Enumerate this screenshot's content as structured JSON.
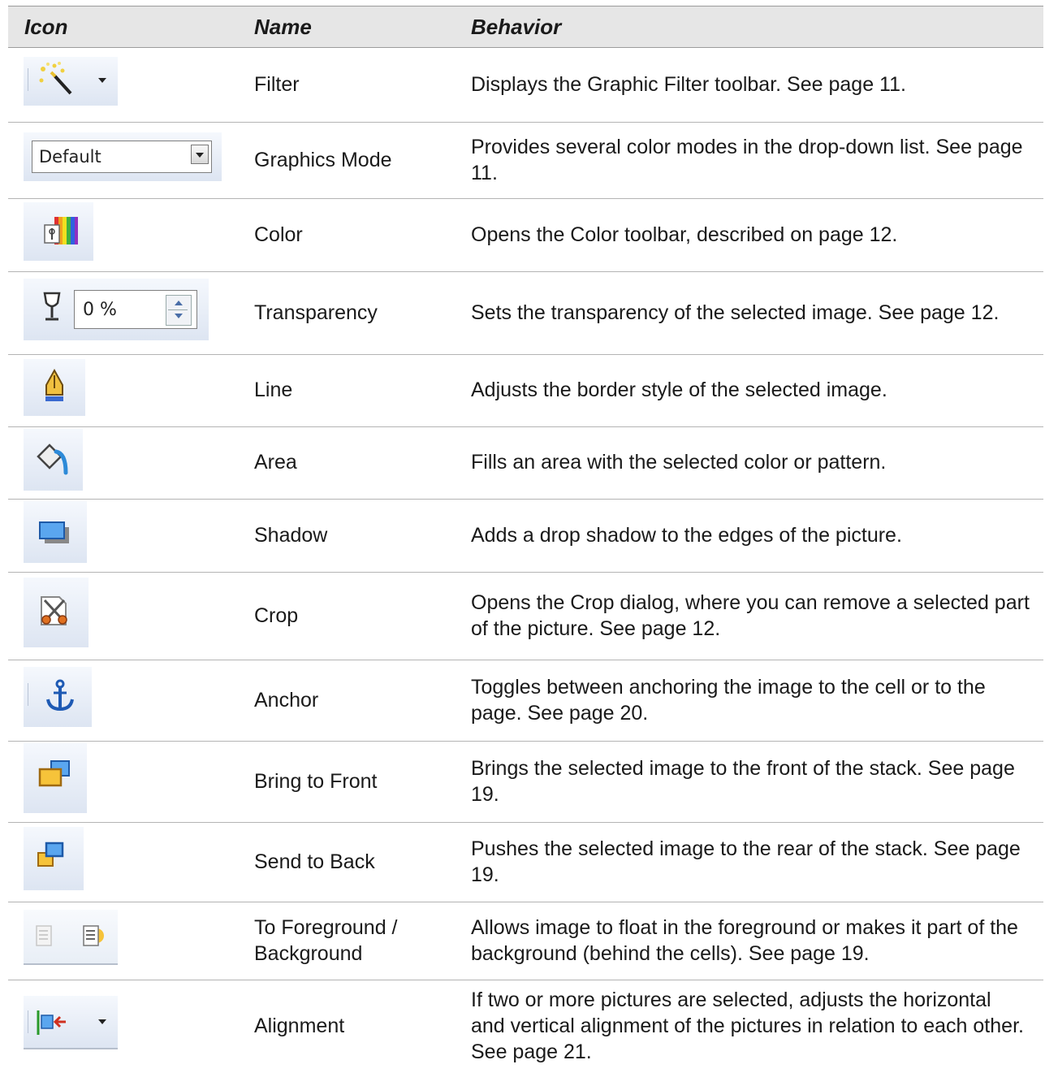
{
  "header": {
    "icon": "Icon",
    "name": "Name",
    "behavior": "Behavior"
  },
  "rows": [
    {
      "icon": "magic-wand-filter-icon",
      "name": "Filter",
      "behavior": "Displays the Graphic Filter toolbar. See page 11."
    },
    {
      "icon": "graphics-mode-combo",
      "name": "Graphics Mode",
      "behavior": "Provides several color modes in the drop-down list. See page 11.",
      "combo_value": "Default"
    },
    {
      "icon": "color-icon",
      "name": "Color",
      "behavior": "Opens the Color toolbar, described on page 12."
    },
    {
      "icon": "transparency-icon",
      "name": "Transparency",
      "behavior": "Sets the transparency of the selected image. See page 12.",
      "spin_value": "0 %"
    },
    {
      "icon": "line-pen-icon",
      "name": "Line",
      "behavior": "Adjusts the border style of the selected image."
    },
    {
      "icon": "area-bucket-icon",
      "name": "Area",
      "behavior": "Fills an area with the selected color or pattern."
    },
    {
      "icon": "shadow-icon",
      "name": "Shadow",
      "behavior": "Adds a drop shadow to the edges of the picture."
    },
    {
      "icon": "crop-scissors-icon",
      "name": "Crop",
      "behavior": "Opens the Crop dialog, where you can remove a selected part of the picture. See page 12."
    },
    {
      "icon": "anchor-icon",
      "name": "Anchor",
      "behavior": "Toggles between anchoring the image to the cell or to the page. See page 20."
    },
    {
      "icon": "bring-to-front-icon",
      "name": "Bring to Front",
      "behavior": "Brings the selected image to the front of the stack. See page 19."
    },
    {
      "icon": "send-to-back-icon",
      "name": "Send to Back",
      "behavior": "Pushes the selected image to the rear of the stack. See page 19."
    },
    {
      "icon": "foreground-background-icon",
      "name": "To Foreground / Background",
      "behavior": "Allows image to float in the foreground or makes it part of the background (behind the cells). See page 19."
    },
    {
      "icon": "alignment-icon",
      "name": "Alignment",
      "behavior": "If two or more pictures are selected, adjusts the horizontal and vertical alignment of the pictures in relation to each other. See page 21."
    }
  ]
}
